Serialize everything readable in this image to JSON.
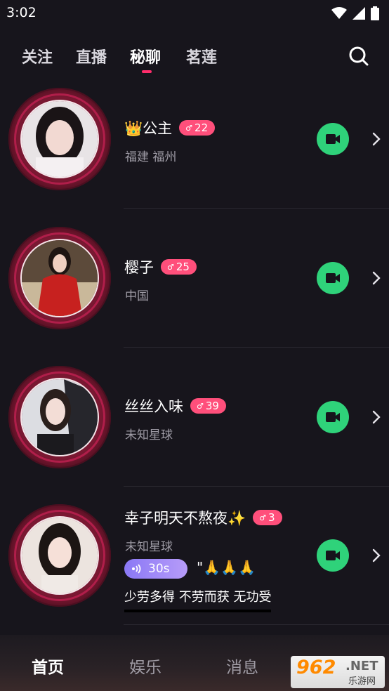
{
  "status_bar": {
    "time": "3:02",
    "icons": [
      "wifi-icon",
      "signal-icon",
      "battery-icon"
    ]
  },
  "top_tabs": [
    {
      "label": "关注",
      "active": false
    },
    {
      "label": "直播",
      "active": false
    },
    {
      "label": "秘聊",
      "active": true
    },
    {
      "label": "茗莲",
      "active": false
    }
  ],
  "colors": {
    "accent": "#ff2d6b",
    "badge": "#ff4f7b",
    "video_button": "#2fd27a",
    "voice_pill": "#8a78f5"
  },
  "users": [
    {
      "name": "公主",
      "crown": "👑",
      "age": "22",
      "location": "福建 福州"
    },
    {
      "name": "樱子",
      "age": "25",
      "location": "中国"
    },
    {
      "name": "丝丝入味",
      "age": "39",
      "location": "未知星球"
    },
    {
      "name": "幸子明天不熬夜✨",
      "age": "3",
      "location": "未知星球",
      "voice_length": "30s",
      "quote": "\"🙏🙏🙏",
      "motto": "少劳多得 不劳而获 无功受"
    }
  ],
  "bottom_nav": [
    {
      "label": "首页",
      "active": true
    },
    {
      "label": "娱乐",
      "active": false
    },
    {
      "label": "消息",
      "active": false
    }
  ],
  "watermark": {
    "big": "962",
    "net": ".NET",
    "sub": "乐游网"
  }
}
